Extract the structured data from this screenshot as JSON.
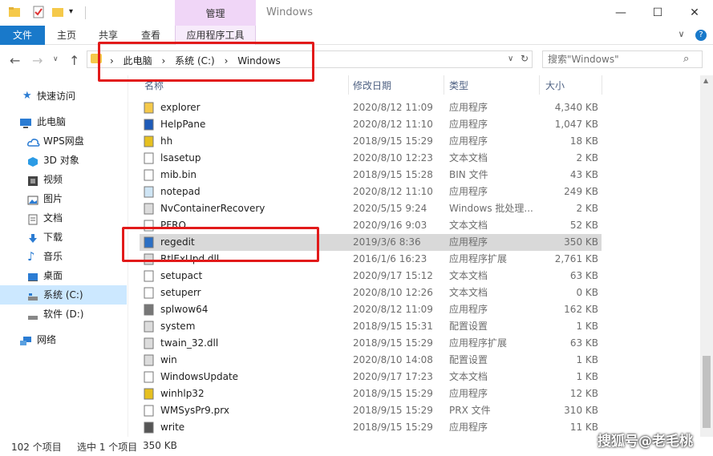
{
  "window": {
    "title": "Windows",
    "manage_tab": "管理",
    "minimize": "—",
    "maximize": "☐",
    "close": "✕"
  },
  "ribbon": {
    "tabs": [
      "文件",
      "主页",
      "共享",
      "查看",
      "应用程序工具"
    ],
    "right_chevron": "∨",
    "help": "?"
  },
  "address": {
    "crumbs": [
      "此电脑",
      "系统 (C:)",
      "Windows"
    ],
    "separator": "›",
    "dropdown": "∨",
    "refresh": "↻"
  },
  "search": {
    "placeholder": "搜索\"Windows\""
  },
  "sidebar": {
    "items": [
      {
        "label": "快速访问",
        "icon": "star-icon",
        "color": "#2b7cd3"
      },
      {
        "label": "此电脑",
        "icon": "computer-icon",
        "color": "#2b7cd3"
      },
      {
        "label": "WPS网盘",
        "icon": "cloud-icon",
        "color": "#2b7cd3"
      },
      {
        "label": "3D 对象",
        "icon": "cube-icon",
        "color": "#2b9be5"
      },
      {
        "label": "视频",
        "icon": "video-icon",
        "color": "#444444"
      },
      {
        "label": "图片",
        "icon": "picture-icon",
        "color": "#2b7cd3"
      },
      {
        "label": "文档",
        "icon": "document-icon",
        "color": "#666666"
      },
      {
        "label": "下载",
        "icon": "download-icon",
        "color": "#2b7cd3"
      },
      {
        "label": "音乐",
        "icon": "music-icon",
        "color": "#2b7cd3"
      },
      {
        "label": "桌面",
        "icon": "desktop-icon",
        "color": "#2b7cd3"
      },
      {
        "label": "系统 (C:)",
        "icon": "drive-icon",
        "color": "#888888"
      },
      {
        "label": "软件 (D:)",
        "icon": "drive-icon",
        "color": "#888888"
      },
      {
        "label": "网络",
        "icon": "network-icon",
        "color": "#2b7cd3"
      }
    ]
  },
  "columns": {
    "name": "名称",
    "date": "修改日期",
    "type": "类型",
    "size": "大小"
  },
  "files": [
    {
      "name": "explorer",
      "date": "2020/8/12 11:09",
      "type": "应用程序",
      "size": "4,340 KB",
      "icon": "explorer-icon",
      "color": "#f5c94a"
    },
    {
      "name": "HelpPane",
      "date": "2020/8/12 11:10",
      "type": "应用程序",
      "size": "1,047 KB",
      "icon": "help-icon",
      "color": "#1e5bb8"
    },
    {
      "name": "hh",
      "date": "2018/9/15 15:29",
      "type": "应用程序",
      "size": "18 KB",
      "icon": "hh-icon",
      "color": "#e6c020"
    },
    {
      "name": "lsasetup",
      "date": "2020/8/10 12:23",
      "type": "文本文档",
      "size": "2 KB",
      "icon": "text-file-icon",
      "color": "#ffffff"
    },
    {
      "name": "mib.bin",
      "date": "2018/9/15 15:28",
      "type": "BIN 文件",
      "size": "43 KB",
      "icon": "file-icon",
      "color": "#ffffff"
    },
    {
      "name": "notepad",
      "date": "2020/8/12 11:10",
      "type": "应用程序",
      "size": "249 KB",
      "icon": "notepad-icon",
      "color": "#cfe5f5"
    },
    {
      "name": "NvContainerRecovery",
      "date": "2020/5/15 9:24",
      "type": "Windows 批处理...",
      "size": "2 KB",
      "icon": "batch-file-icon",
      "color": "#dcdcdc"
    },
    {
      "name": "PFRO",
      "date": "2020/9/16 9:03",
      "type": "文本文档",
      "size": "52 KB",
      "icon": "text-file-icon",
      "color": "#ffffff"
    },
    {
      "name": "regedit",
      "date": "2019/3/6 8:36",
      "type": "应用程序",
      "size": "350 KB",
      "icon": "regedit-icon",
      "color": "#2b6fc4"
    },
    {
      "name": "RtlExUpd.dll",
      "date": "2016/1/6 16:23",
      "type": "应用程序扩展",
      "size": "2,761 KB",
      "icon": "dll-icon",
      "color": "#dcdcdc"
    },
    {
      "name": "setupact",
      "date": "2020/9/17 15:12",
      "type": "文本文档",
      "size": "63 KB",
      "icon": "text-file-icon",
      "color": "#ffffff"
    },
    {
      "name": "setuperr",
      "date": "2020/8/10 12:26",
      "type": "文本文档",
      "size": "0 KB",
      "icon": "text-file-icon",
      "color": "#ffffff"
    },
    {
      "name": "splwow64",
      "date": "2020/8/12 11:09",
      "type": "应用程序",
      "size": "162 KB",
      "icon": "printer-icon",
      "color": "#777777"
    },
    {
      "name": "system",
      "date": "2018/9/15 15:31",
      "type": "配置设置",
      "size": "1 KB",
      "icon": "config-file-icon",
      "color": "#dcdcdc"
    },
    {
      "name": "twain_32.dll",
      "date": "2018/9/15 15:29",
      "type": "应用程序扩展",
      "size": "63 KB",
      "icon": "dll-icon",
      "color": "#dcdcdc"
    },
    {
      "name": "win",
      "date": "2020/8/10 14:08",
      "type": "配置设置",
      "size": "1 KB",
      "icon": "config-file-icon",
      "color": "#dcdcdc"
    },
    {
      "name": "WindowsUpdate",
      "date": "2020/9/17 17:23",
      "type": "文本文档",
      "size": "1 KB",
      "icon": "text-file-icon",
      "color": "#ffffff"
    },
    {
      "name": "winhlp32",
      "date": "2018/9/15 15:29",
      "type": "应用程序",
      "size": "12 KB",
      "icon": "winhlp-icon",
      "color": "#e6c020"
    },
    {
      "name": "WMSysPr9.prx",
      "date": "2018/9/15 15:29",
      "type": "PRX 文件",
      "size": "310 KB",
      "icon": "file-icon",
      "color": "#ffffff"
    },
    {
      "name": "write",
      "date": "2018/9/15 15:29",
      "type": "应用程序",
      "size": "11 KB",
      "icon": "write-icon",
      "color": "#555555"
    }
  ],
  "status": {
    "count": "102 个项目",
    "selected": "选中 1 个项目",
    "size": "350 KB"
  },
  "watermark": "搜狐号@老毛桃",
  "colors": {
    "accent": "#1979ca",
    "selection": "#d9d9d9",
    "manage_tab": "#f0d6f7",
    "annotation": "#e21a1a"
  }
}
